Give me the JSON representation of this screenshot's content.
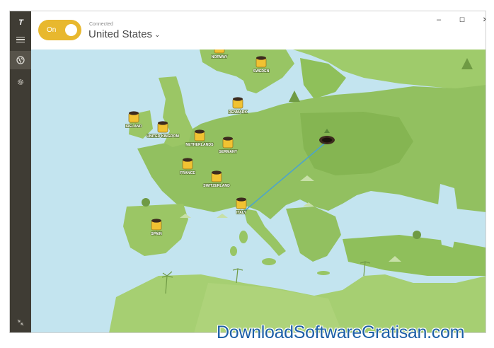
{
  "app": {
    "logo": "T"
  },
  "toggle": {
    "label": "On",
    "state": "on"
  },
  "connection": {
    "status": "Connected",
    "country": "United States"
  },
  "window_controls": {
    "minimize": "–",
    "maximize": "☐",
    "close": "✕"
  },
  "map": {
    "markers": [
      {
        "name": "NORWAY"
      },
      {
        "name": "SWEDEN"
      },
      {
        "name": "DENMARK"
      },
      {
        "name": "IRELAND"
      },
      {
        "name": "UNITED KINGDOM"
      },
      {
        "name": "NETHERLANDS"
      },
      {
        "name": "GERMANY"
      },
      {
        "name": "FRANCE"
      },
      {
        "name": "SWITZERLAND"
      },
      {
        "name": "ITALY"
      },
      {
        "name": "SPAIN"
      }
    ]
  },
  "watermark": "DownloadSoftwareGratisan.com",
  "colors": {
    "accent": "#e8b82e",
    "sidebar": "#3f3c34",
    "sea": "#c3e4ef",
    "land": "#92c060",
    "route": "#4aa3cf"
  }
}
